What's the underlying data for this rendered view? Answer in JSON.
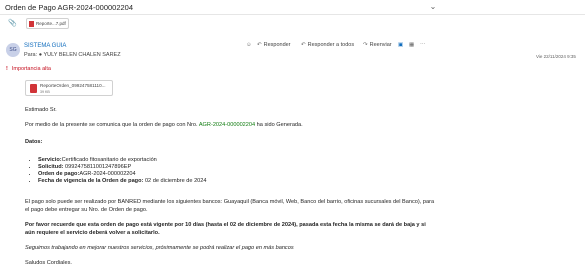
{
  "window": {
    "title": "Orden de Pago AGR-2024-000002204"
  },
  "attachment_bar": {
    "chip_label": "Reporte...7.pdf"
  },
  "sender": {
    "avatar_initials": "SG",
    "name": "SISTEMA GUIA",
    "to_prefix": "Para:",
    "to_name": "YULY BELEN CHALEN SAREZ",
    "date": "Vie 22/11/2024 9:35"
  },
  "actions": {
    "reply": "Responder",
    "reply_all": "Responder a todos",
    "forward": "Reenviar"
  },
  "importance": {
    "label": "Importancia alta"
  },
  "attachment": {
    "file_name": "ReporteOrden_099247581110...",
    "file_size": "39 KB"
  },
  "message": {
    "greeting": "Estimado Sr.",
    "intro_before": "Por medio de la presente se comunica que la orden de pago con Nro. ",
    "order_number": "AGR-2024-000002204",
    "intro_after": " ha sido Generada.",
    "datos_title": "Datos:",
    "fields": [
      {
        "label": "Servicio:",
        "value": "Certificado fitosanitario de exportación"
      },
      {
        "label": "Solicitud:",
        "value": " 0992475811001247896EP"
      },
      {
        "label": "Orden de pago:",
        "value": "AGR-2024-000002204"
      },
      {
        "label": "Fecha de vigencia de la Orden de pago:",
        "value": " 02 de diciembre de 2024"
      }
    ],
    "payment_line1": "El pago solo puede ser realizado por BANRED mediante los siguientes bancos: Guayaquil (Banca móvil, Web, Banco del barrio, oficinas sucursales del Banco), para",
    "payment_line2": "el pago debe entregar su Nro. de Orden de pago.",
    "warning_line1": "Por favor recuerde que esta orden de pago está vigente por 10 días (hasta el 02 de diciembre de 2024), pasada esta fecha la misma se dará de baja y si",
    "warning_line2": "aún requiere el servicio deberá volver a solicitarlo.",
    "note": "Seguimos trabajando en mejorar nuestros servicios, próximamente se podrá realizar el pago en más bancos",
    "closing": "Saludos Cordiales."
  },
  "icons": {
    "colors": {
      "accent": "#0f6cbd",
      "importance": "#c50f1f",
      "pdf": "#d13438",
      "link_green": "#107c10"
    }
  }
}
